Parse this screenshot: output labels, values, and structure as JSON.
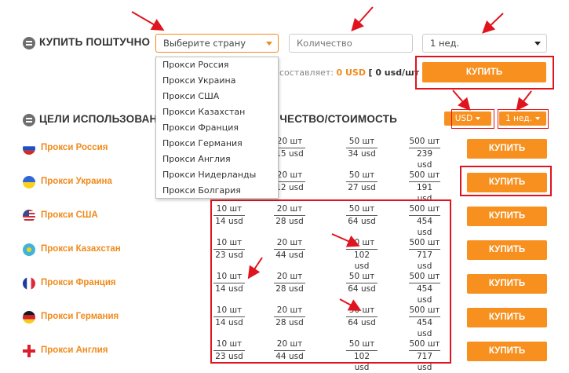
{
  "section1": {
    "title": "КУПИТЬ ПОШТУЧНО"
  },
  "country_select": {
    "value": "Выберите страну"
  },
  "quantity_input": {
    "placeholder": "Количество"
  },
  "period_select": {
    "value": "1 нед."
  },
  "summary": {
    "text": "составляет:",
    "amount": "0 USD",
    "rate": "[ 0 usd/шт ]"
  },
  "buy_button_label": "КУПИТЬ",
  "dropdown": {
    "options": [
      "Прокси Россия",
      "Прокси Украина",
      "Прокси США",
      "Прокси Казахстан",
      "Прокси Франция",
      "Прокси Германия",
      "Прокси Англия",
      "Прокси Нидерланды",
      "Прокси Болгария"
    ]
  },
  "section2": {
    "title": "ЦЕЛИ ИСПОЛЬЗОВАНИЯ",
    "column_title": "КОЛИЧЕСТВО/СТОИМОСТЬ"
  },
  "currency_button": "USD",
  "period_button": "1 нед.",
  "colors": {
    "accent": "#f7901e",
    "label": "#f08a1c",
    "annotation": "#e0141e"
  },
  "rows": [
    {
      "label": "Прокси Россия",
      "flag": "russia-flag-icon",
      "cols": [
        {
          "q": "",
          "p": ""
        },
        {
          "q": "20 шт",
          "p": "15 usd"
        },
        {
          "q": "50 шт",
          "p": "34 usd"
        },
        {
          "q": "500 шт",
          "p": "239 usd"
        }
      ]
    },
    {
      "label": "Прокси Украина",
      "flag": "ukraine-flag-icon",
      "cols": [
        {
          "q": "",
          "p": ""
        },
        {
          "q": "20 шт",
          "p": "12 usd"
        },
        {
          "q": "50 шт",
          "p": "27 usd"
        },
        {
          "q": "500 шт",
          "p": "191 usd"
        }
      ]
    },
    {
      "label": "Прокси США",
      "flag": "usa-flag-icon",
      "cols": [
        {
          "q": "10 шт",
          "p": "14 usd"
        },
        {
          "q": "20 шт",
          "p": "28 usd"
        },
        {
          "q": "50 шт",
          "p": "64 usd"
        },
        {
          "q": "500 шт",
          "p": "454 usd"
        }
      ]
    },
    {
      "label": "Прокси Казахстан",
      "flag": "kazakhstan-flag-icon",
      "cols": [
        {
          "q": "10 шт",
          "p": "23 usd"
        },
        {
          "q": "20 шт",
          "p": "44 usd"
        },
        {
          "q": "50 шт",
          "p": "102 usd"
        },
        {
          "q": "500 шт",
          "p": "717 usd"
        }
      ]
    },
    {
      "label": "Прокси Франция",
      "flag": "france-flag-icon",
      "cols": [
        {
          "q": "10 шт",
          "p": "14 usd"
        },
        {
          "q": "20 шт",
          "p": "28 usd"
        },
        {
          "q": "50 шт",
          "p": "64 usd"
        },
        {
          "q": "500 шт",
          "p": "454 usd"
        }
      ]
    },
    {
      "label": "Прокси Германия",
      "flag": "germany-flag-icon",
      "cols": [
        {
          "q": "10 шт",
          "p": "14 usd"
        },
        {
          "q": "20 шт",
          "p": "28 usd"
        },
        {
          "q": "50 шт",
          "p": "64 usd"
        },
        {
          "q": "500 шт",
          "p": "454 usd"
        }
      ]
    },
    {
      "label": "Прокси Англия",
      "flag": "england-flag-icon",
      "cols": [
        {
          "q": "10 шт",
          "p": "23 usd"
        },
        {
          "q": "20 шт",
          "p": "44 usd"
        },
        {
          "q": "50 шт",
          "p": "102 usd"
        },
        {
          "q": "500 шт",
          "p": "717 usd"
        }
      ]
    }
  ]
}
